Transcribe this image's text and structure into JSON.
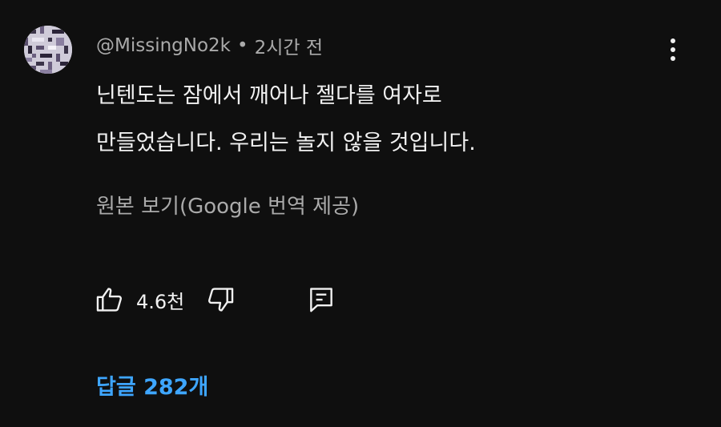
{
  "comment": {
    "author": "@MissingNo2k",
    "separator": "•",
    "time": "2시간 전",
    "line1": "닌텐도는 잠에서 깨어나 젤다를 여자로",
    "line2": "만들었습니다. 우리는 놀지 않을 것입니다.",
    "translate_label": "원본 보기(Google 번역 제공)",
    "like_count": "4.6천",
    "replies_label": "답글 282개"
  },
  "icons": {
    "avatar": "pixel-glitch-avatar",
    "more": "vertical-dots-icon",
    "like": "thumbs-up-icon",
    "dislike": "thumbs-down-icon",
    "reply": "comment-reply-icon"
  },
  "colors": {
    "background": "#0f0f0f",
    "text": "#f1f1f1",
    "secondary": "#aaaaaa",
    "link": "#3ea6ff"
  }
}
